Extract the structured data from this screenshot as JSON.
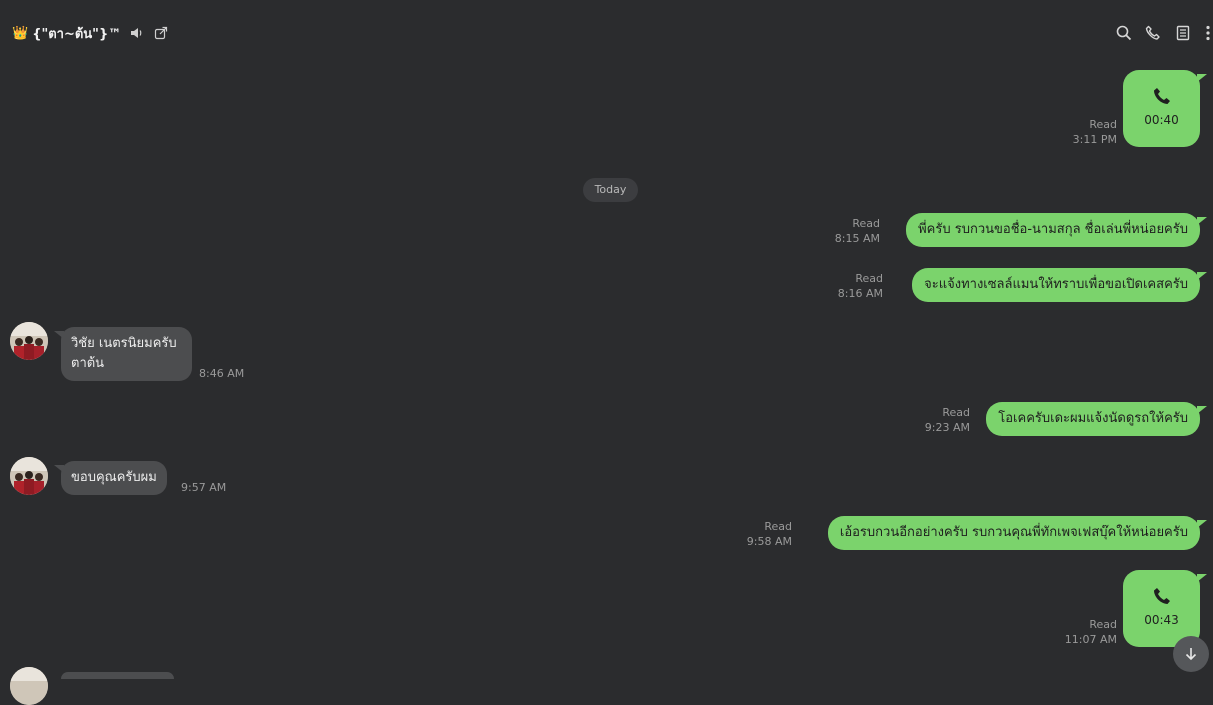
{
  "header": {
    "crown_icon": "👑",
    "title": "{\"ตา~ต้น\"}™",
    "icons": [
      "speaker-icon",
      "external-window-icon",
      "search-icon",
      "phone-icon",
      "notes-icon",
      "more-vertical-icon"
    ]
  },
  "separator": {
    "today": "Today"
  },
  "messages": [
    {
      "dir": "out",
      "type": "call",
      "duration": "00:40",
      "read": "Read",
      "time": "3:11 PM"
    },
    {
      "dir": "out",
      "type": "text",
      "text": "พี่ครับ รบกวนขอชื่อ-นามสกุล ชื่อเล่นพี่หน่อยครับ",
      "read": "Read",
      "time": "8:15 AM"
    },
    {
      "dir": "out",
      "type": "text",
      "text": "จะแจ้งทางเซลล์แมนให้ทราบเพื่อขอเปิดเคสครับ",
      "read": "Read",
      "time": "8:16 AM"
    },
    {
      "dir": "in",
      "type": "text",
      "lines": [
        "วิชัย เนตรนิยมครับ",
        "ตาต้น"
      ],
      "time": "8:46 AM"
    },
    {
      "dir": "out",
      "type": "text",
      "text": "โอเคครับเดะผมแจ้งนัดดูรถให้ครับ",
      "read": "Read",
      "time": "9:23 AM"
    },
    {
      "dir": "in",
      "type": "text",
      "text": "ขอบคุณครับผม",
      "time": "9:57 AM"
    },
    {
      "dir": "out",
      "type": "text",
      "text": "เอ้อรบกวนอีกอย่างครับ รบกวนคุณพี่ทักเพจเฟสบุ๊คให้หน่อยครับ",
      "read": "Read",
      "time": "9:58 AM"
    },
    {
      "dir": "out",
      "type": "call",
      "duration": "00:43",
      "read": "Read",
      "time": "11:07 AM"
    }
  ],
  "colors": {
    "outgoing": "#7bd36c",
    "incoming": "#4c4d4f",
    "background": "#2b2c2e"
  }
}
